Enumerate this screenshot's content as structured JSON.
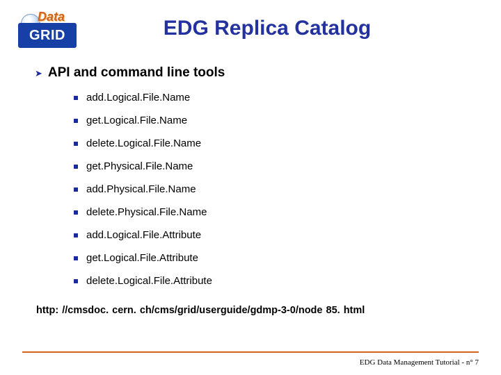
{
  "logo": {
    "top_word": "Data",
    "bottom_word": "GRID"
  },
  "title": "EDG Replica Catalog",
  "section": {
    "heading": "API and command line tools"
  },
  "items": [
    "add.Logical.File.Name",
    "get.Logical.File.Name",
    "delete.Logical.File.Name",
    "get.Physical.File.Name",
    "add.Physical.File.Name",
    "delete.Physical.File.Name",
    "add.Logical.File.Attribute",
    "get.Logical.File.Attribute",
    "delete.Logical.File.Attribute"
  ],
  "link": "http: //cmsdoc. cern. ch/cms/grid/userguide/gdmp-3-0/node 85. html",
  "footer": "EDG Data Management Tutorial - n° 7"
}
